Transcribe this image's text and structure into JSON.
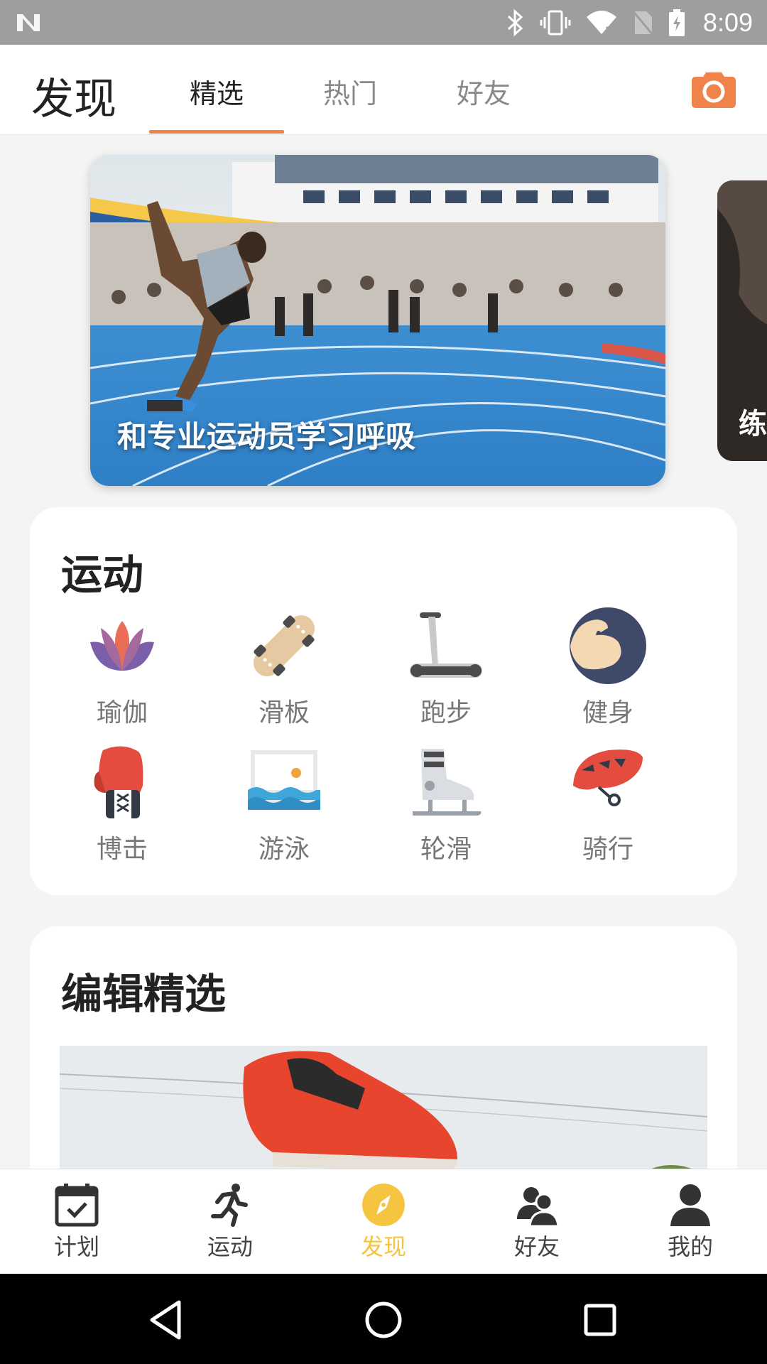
{
  "status_bar": {
    "time": "8:09",
    "icons": [
      "n-logo-icon",
      "bluetooth-icon",
      "vibrate-icon",
      "wifi-icon",
      "no-sim-icon",
      "battery-charging-icon"
    ]
  },
  "header": {
    "title": "发现",
    "tabs": [
      {
        "label": "精选",
        "active": true
      },
      {
        "label": "热门",
        "active": false
      },
      {
        "label": "好友",
        "active": false
      }
    ],
    "camera_icon": "camera-icon",
    "accent_color": "#f0834a"
  },
  "banner": {
    "caption": "和专业运动员学习呼吸",
    "peek_caption": "练"
  },
  "sports": {
    "title": "运动",
    "items": [
      {
        "label": "瑜伽",
        "icon": "lotus-icon"
      },
      {
        "label": "滑板",
        "icon": "skateboard-icon"
      },
      {
        "label": "跑步",
        "icon": "treadmill-icon"
      },
      {
        "label": "健身",
        "icon": "bicep-icon"
      },
      {
        "label": "博击",
        "icon": "boxing-glove-icon"
      },
      {
        "label": "游泳",
        "icon": "swimming-pool-icon"
      },
      {
        "label": "轮滑",
        "icon": "skate-icon"
      },
      {
        "label": "骑行",
        "icon": "helmet-icon"
      }
    ]
  },
  "editor": {
    "title": "编辑精选"
  },
  "bottom_nav": {
    "items": [
      {
        "label": "计划",
        "icon": "calendar-check-icon",
        "active": false
      },
      {
        "label": "运动",
        "icon": "runner-icon",
        "active": false
      },
      {
        "label": "发现",
        "icon": "compass-icon",
        "active": true
      },
      {
        "label": "好友",
        "icon": "friends-icon",
        "active": false
      },
      {
        "label": "我的",
        "icon": "person-icon",
        "active": false
      }
    ],
    "active_color": "#f5c542"
  },
  "system_nav": {
    "icons": [
      "back-icon",
      "home-icon",
      "recents-icon"
    ]
  }
}
